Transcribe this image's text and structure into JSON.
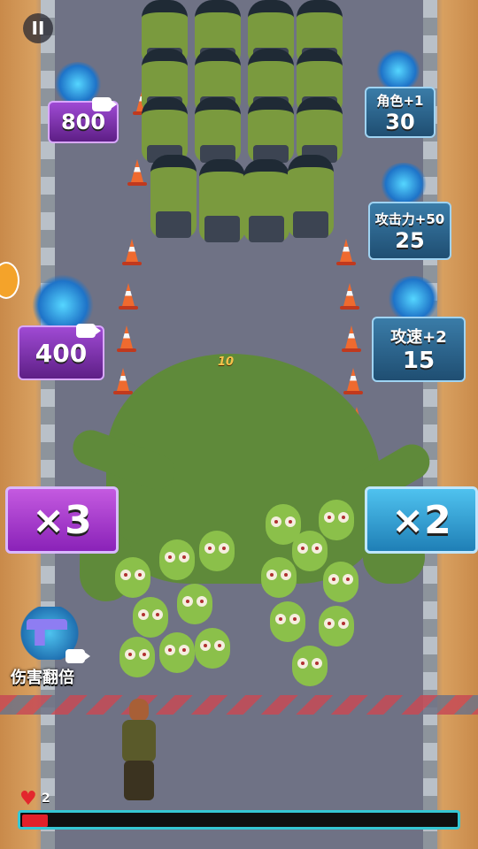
{
  "hud": {
    "pause_label": "II",
    "lives": "2",
    "health_fraction": 0.06
  },
  "floating_damage": "10",
  "pads": {
    "weapon_800": {
      "value": "800",
      "icon": "dagger-icon"
    },
    "character_plus": {
      "label": "角色+1",
      "value": "30",
      "icon": "hero-portrait-icon"
    },
    "attack_power": {
      "label": "攻击力+50",
      "value": "25",
      "icon": "bullet-icon"
    },
    "weapon_400": {
      "value": "400",
      "icon": "trident-icon"
    },
    "attack_speed": {
      "label": "攻速+2",
      "value": "15",
      "icon": "bullet-arrow-icon"
    }
  },
  "gates": {
    "left": "×3",
    "right": "×2"
  },
  "powerup": {
    "label": "伤害翻倍",
    "icon": "pistol-icon"
  },
  "colors": {
    "purple_gate": "#8a22b8",
    "blue_gate": "#1f7fb6",
    "health": "#e2202a",
    "health_border": "#35c7d4"
  }
}
